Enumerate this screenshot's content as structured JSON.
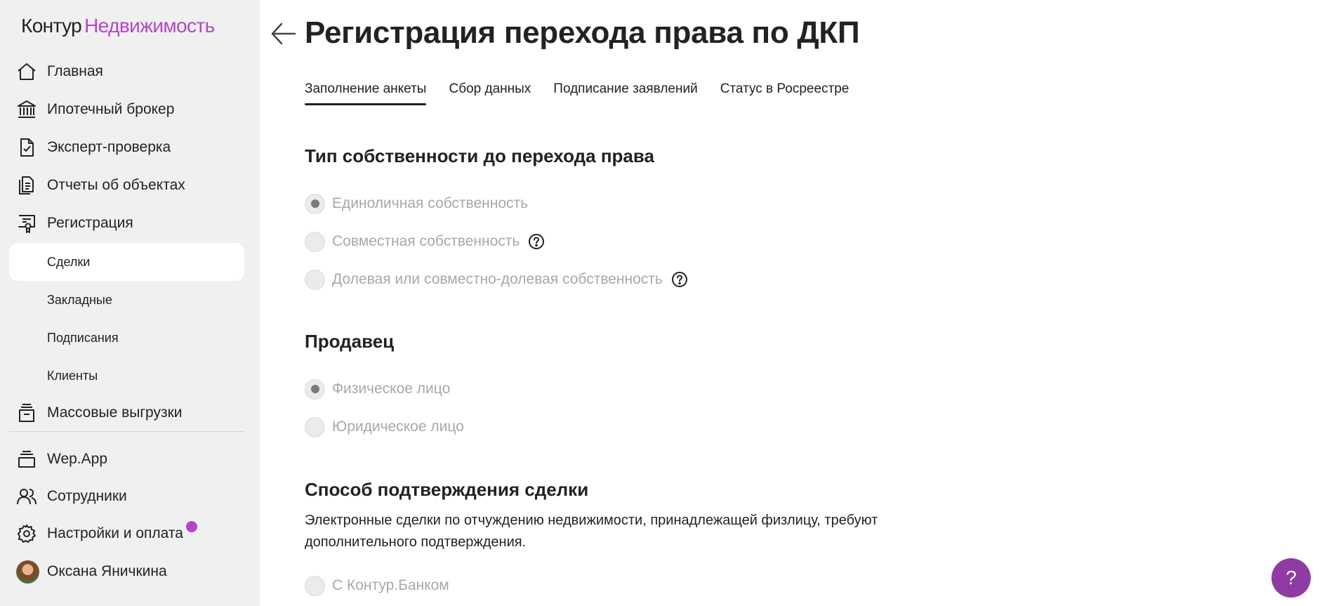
{
  "logo": {
    "part1": "Контур",
    "part2": "Недвижимость"
  },
  "sidebar": {
    "items": [
      {
        "label": "Главная",
        "icon": "home-icon"
      },
      {
        "label": "Ипотечный брокер",
        "icon": "bank-icon"
      },
      {
        "label": "Эксперт-проверка",
        "icon": "document-check-icon"
      },
      {
        "label": "Отчеты об объектах",
        "icon": "reports-icon"
      },
      {
        "label": "Регистрация",
        "icon": "certificate-icon"
      }
    ],
    "sub_items": [
      {
        "label": "Сделки",
        "active": true
      },
      {
        "label": "Закладные"
      },
      {
        "label": "Подписания"
      },
      {
        "label": "Клиенты"
      }
    ],
    "mass_upload": {
      "label": "Массовые выгрузки",
      "icon": "archive-icon"
    },
    "bottom_items": [
      {
        "label": "Wep.App",
        "icon": "stack-icon"
      },
      {
        "label": "Сотрудники",
        "icon": "users-icon"
      },
      {
        "label": "Настройки и оплата",
        "icon": "gear-icon"
      }
    ],
    "user": {
      "name": "Оксана Яничкина"
    }
  },
  "page": {
    "title": "Регистрация перехода права по ДКП",
    "tabs": [
      {
        "label": "Заполнение анкеты",
        "active": true
      },
      {
        "label": "Сбор данных"
      },
      {
        "label": "Подписание заявлений"
      },
      {
        "label": "Статус в Росреестре"
      }
    ]
  },
  "form": {
    "ownership": {
      "title": "Тип собственности до перехода права",
      "options": [
        {
          "label": "Единоличная собственность",
          "selected": true
        },
        {
          "label": "Совместная собственность",
          "help": true
        },
        {
          "label": "Долевая или совместно-долевая собственность",
          "help": true
        }
      ]
    },
    "seller": {
      "title": "Продавец",
      "options": [
        {
          "label": "Физическое лицо",
          "selected": true
        },
        {
          "label": "Юридическое лицо"
        }
      ]
    },
    "confirmation": {
      "title": "Способ подтверждения сделки",
      "description": "Электронные сделки по отчуждению недвижимости, принадлежащей физлицу, требуют дополнительного подтверждения.",
      "options": [
        {
          "label": "С Контур.Банком"
        }
      ]
    }
  },
  "help_fab": {
    "label": "?"
  },
  "colors": {
    "accent": "#b247c7",
    "fab": "#8f3ba3",
    "sidebar_bg": "#f0f0f0",
    "disabled_text": "#a8a8a8"
  }
}
